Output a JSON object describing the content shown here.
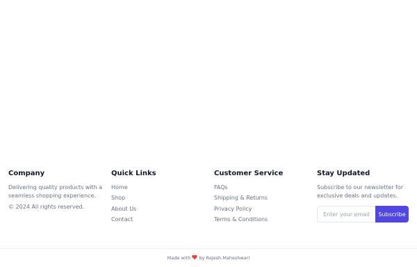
{
  "company": {
    "heading": "Company",
    "description": "Delivering quality products with a seamless shopping experience.",
    "copyright": "© 2024 All rights reserved."
  },
  "quick_links": {
    "heading": "Quick Links",
    "items": [
      "Home",
      "Shop",
      "About Us",
      "Contact"
    ]
  },
  "customer_service": {
    "heading": "Customer Service",
    "items": [
      "FAQs",
      "Shipping & Returns",
      "Privacy Policy",
      "Terms & Conditions"
    ]
  },
  "newsletter": {
    "heading": "Stay Updated",
    "description": "Subscribe to our newsletter for exclusive deals and updates.",
    "input_placeholder": "Enter your email",
    "input_value": "",
    "button_label": "Subscribe"
  },
  "bottom_bar": {
    "prefix": "Made with",
    "suffix": "by Rajesh Maheshwari",
    "heart_icon": "heart-icon"
  },
  "colors": {
    "accent": "#4f46e5",
    "heart": "#e53e3e",
    "heading": "#111827",
    "text": "#6b7280"
  }
}
